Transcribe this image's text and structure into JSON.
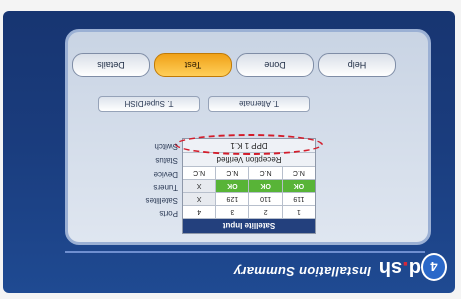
{
  "page_number": "4",
  "brand": {
    "logo_text": "d",
    "logo_dot": ".",
    "logo_tail": "sh"
  },
  "title": "Installation Summary",
  "satellite_table": {
    "header": "Satellite Input",
    "ports": [
      "1",
      "2",
      "3",
      "4"
    ],
    "satellites": [
      "119",
      "110",
      "129",
      "X"
    ],
    "status": [
      "OK",
      "OK",
      "OK",
      "X"
    ],
    "device": [
      "N.C",
      "N.C",
      "N.C",
      "N.C"
    ]
  },
  "row_labels": [
    "Ports",
    "Satellites",
    "Tuners",
    "Device",
    "Status",
    "Switch"
  ],
  "status_text": "Reception Verified",
  "switch_text": "DPP 1 K.1",
  "options": {
    "left": "T. Alternate",
    "right": "T. SuperDISH"
  },
  "nav": [
    {
      "label": "Details",
      "active": false
    },
    {
      "label": "Test",
      "active": true
    },
    {
      "label": "Done",
      "active": false
    },
    {
      "label": "Help",
      "active": false
    }
  ],
  "colors": {
    "accent": "#f0a118",
    "ok": "#58b437",
    "oval": "#d31d2b"
  }
}
